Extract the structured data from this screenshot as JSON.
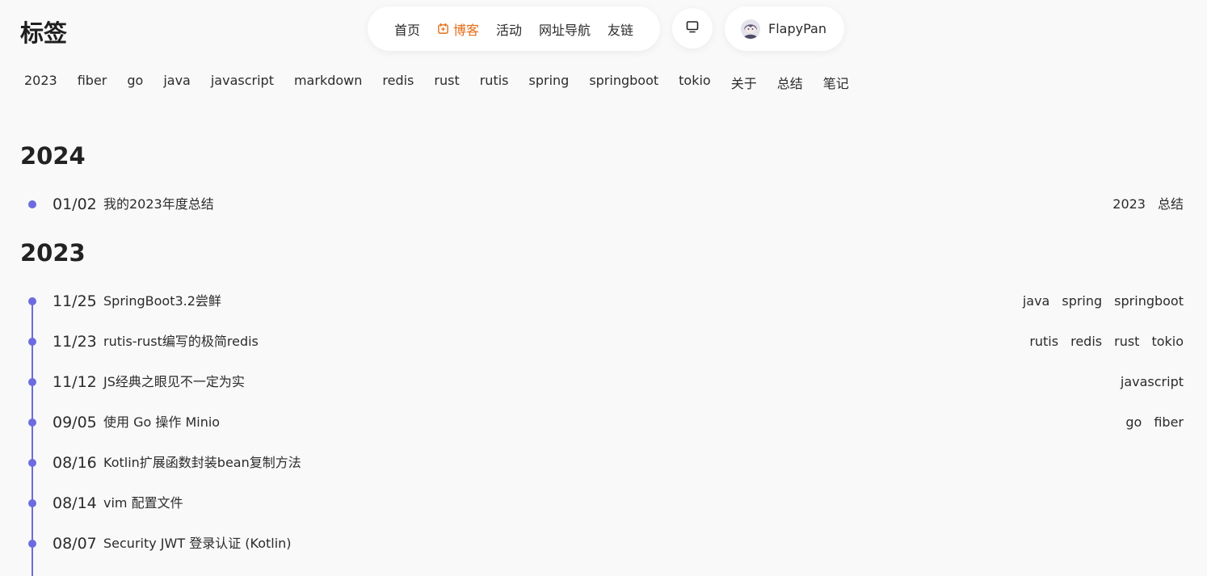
{
  "page": {
    "title": "标签"
  },
  "nav": {
    "items": [
      {
        "label": "首页",
        "active": false
      },
      {
        "label": "博客",
        "active": true,
        "icon": "blog-icon"
      },
      {
        "label": "活动",
        "active": false
      },
      {
        "label": "网址导航",
        "active": false
      },
      {
        "label": "友链",
        "active": false
      }
    ],
    "accent_color": "#e36e19"
  },
  "display_button": {
    "icon": "monitor-icon"
  },
  "user": {
    "name": "FlapyPan",
    "avatar_icon": "avatar"
  },
  "tags": [
    "2023",
    "fiber",
    "go",
    "java",
    "javascript",
    "markdown",
    "redis",
    "rust",
    "rutis",
    "spring",
    "springboot",
    "tokio",
    "关于",
    "总结",
    "笔记"
  ],
  "timeline_color": "#6c6ce0",
  "years": [
    {
      "year": "2024",
      "posts": [
        {
          "date": "01/02",
          "title": "我的2023年度总结",
          "tags": [
            "2023",
            "总结"
          ]
        }
      ]
    },
    {
      "year": "2023",
      "posts": [
        {
          "date": "11/25",
          "title": "SpringBoot3.2尝鲜",
          "tags": [
            "java",
            "spring",
            "springboot"
          ]
        },
        {
          "date": "11/23",
          "title": "rutis-rust编写的极简redis",
          "tags": [
            "rutis",
            "redis",
            "rust",
            "tokio"
          ]
        },
        {
          "date": "11/12",
          "title": "JS经典之眼见不一定为实",
          "tags": [
            "javascript"
          ]
        },
        {
          "date": "09/05",
          "title": "使用 Go 操作 Minio",
          "tags": [
            "go",
            "fiber"
          ]
        },
        {
          "date": "08/16",
          "title": "Kotlin扩展函数封装bean复制方法",
          "tags": []
        },
        {
          "date": "08/14",
          "title": "vim 配置文件",
          "tags": []
        },
        {
          "date": "08/07",
          "title": "Security JWT 登录认证 (Kotlin)",
          "tags": []
        }
      ]
    }
  ]
}
